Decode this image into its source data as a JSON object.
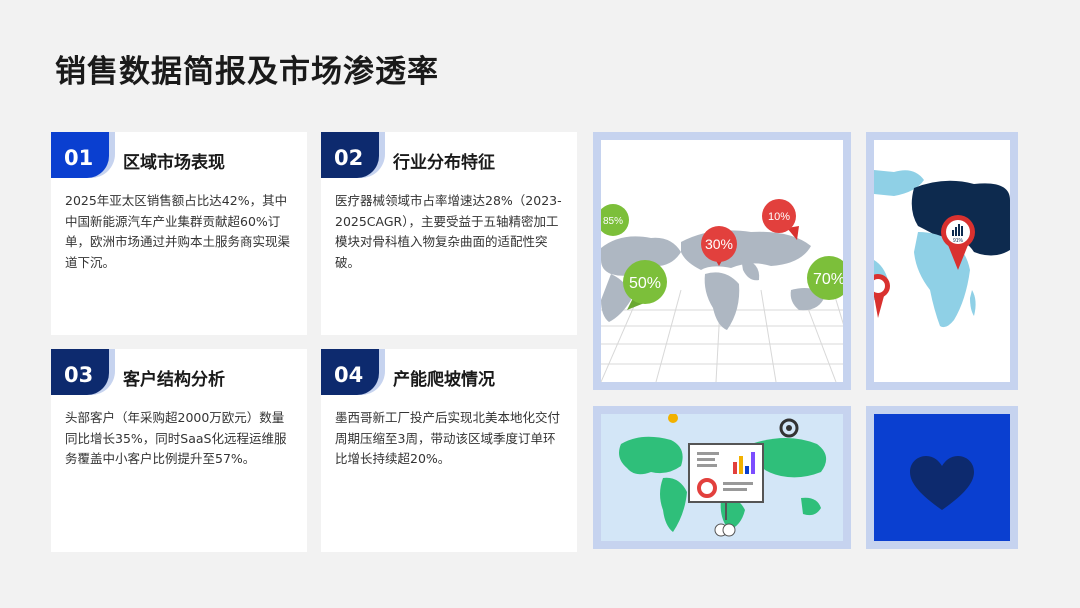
{
  "page": {
    "title": "销售数据简报及市场渗透率"
  },
  "cards": [
    {
      "number": "01",
      "title": "区域市场表现",
      "body": "2025年亚太区销售额占比达42%，其中中国新能源汽车产业集群贡献超60%订单，欧洲市场通过并购本土服务商实现渠道下沉。"
    },
    {
      "number": "02",
      "title": "行业分布特征",
      "body": "医疗器械领域市占率增速达28%（2023-2025CAGR），主要受益于五轴精密加工模块对骨科植入物复杂曲面的适配性突破。"
    },
    {
      "number": "03",
      "title": "客户结构分析",
      "body": "头部客户（年采购超2000万欧元）数量同比增长35%，同时SaaS化远程运维服务覆盖中小客户比例提升至57%。"
    },
    {
      "number": "04",
      "title": "产能爬坡情况",
      "body": "墨西哥新工厂投产后实现北美本地化交付周期压缩至3周，带动该区域季度订单环比增长持续超20%。"
    }
  ],
  "images": {
    "map_pins": {
      "labels": [
        "85%",
        "30%",
        "10%",
        "50%",
        "70%"
      ]
    },
    "map_dark": {
      "pin_label": "91%"
    },
    "colors": {
      "blue": "#0a3fd0",
      "navy": "#0d2a6e",
      "tile_border": "#c6d3ef"
    }
  }
}
